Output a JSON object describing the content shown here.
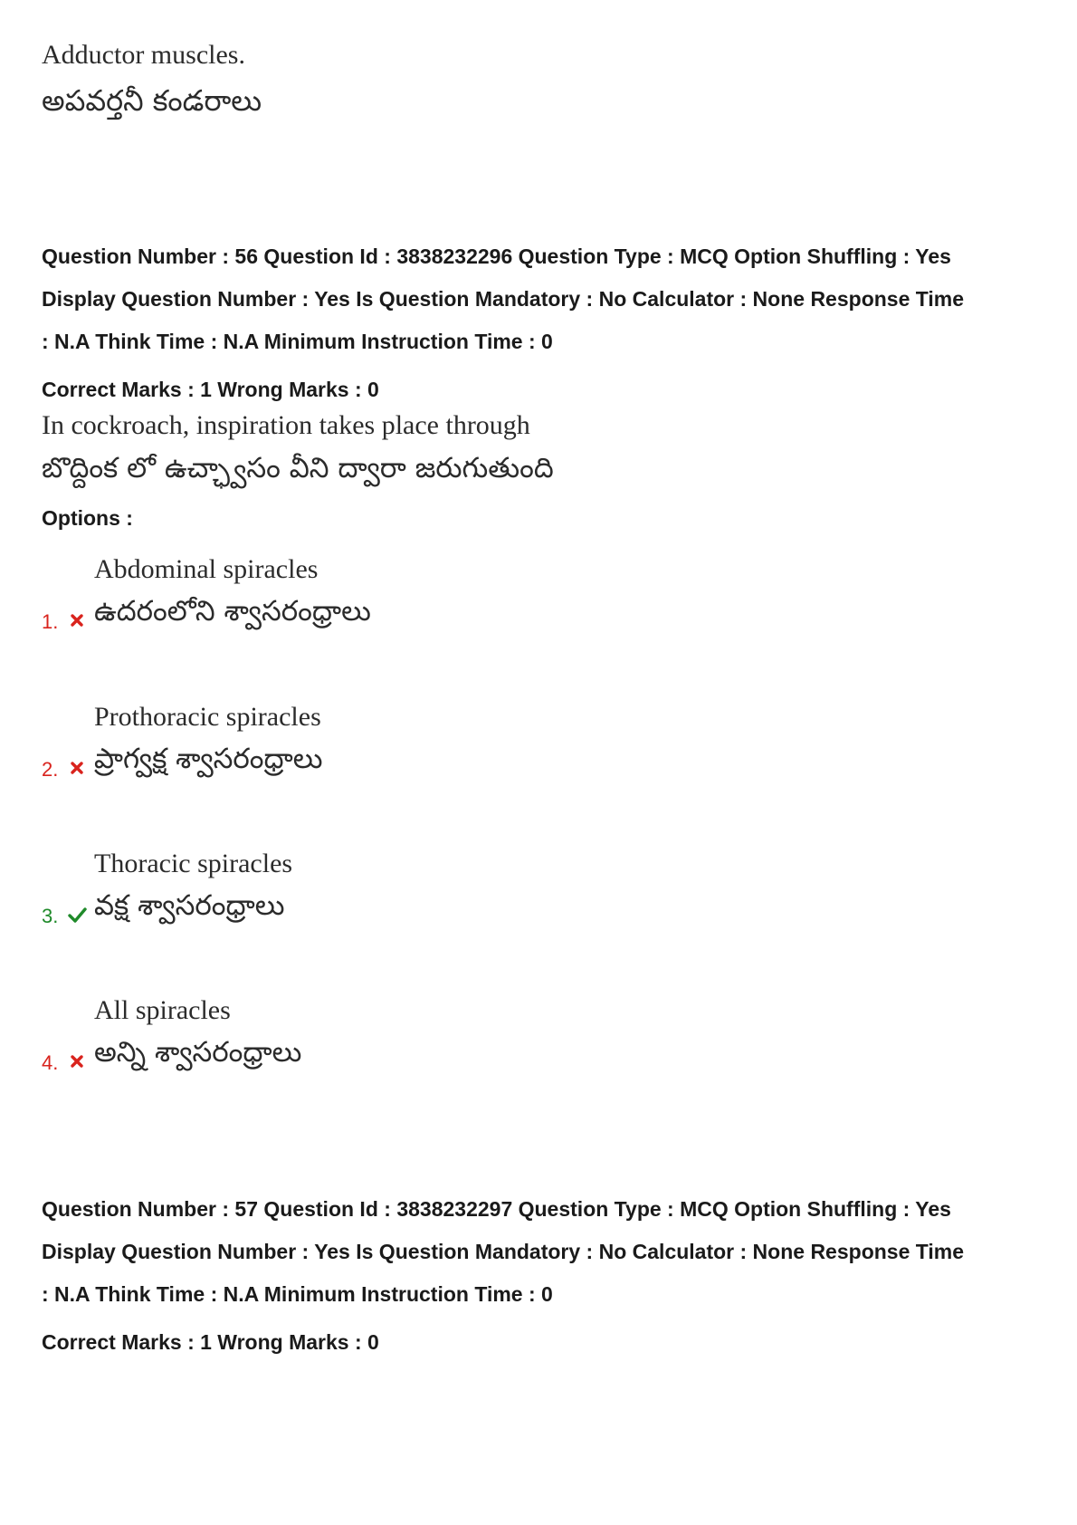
{
  "previous_answer": {
    "english": "Adductor muscles.",
    "telugu": "అపవర్తనీ కండరాలు"
  },
  "question_56": {
    "meta_line1": "Question Number : 56 Question Id : 3838232296 Question Type : MCQ Option Shuffling : Yes",
    "meta_line2": "Display Question Number : Yes Is Question Mandatory : No Calculator : None Response Time",
    "meta_line3": ": N.A Think Time : N.A Minimum Instruction Time : 0",
    "marks": "Correct Marks : 1 Wrong Marks : 0",
    "text_english": "In cockroach, inspiration takes place through",
    "text_telugu": "బొద్దింక లో ఉచ్ఛ్వాసం వీని ద్వారా జరుగుతుంది",
    "options_label": "Options :",
    "options": [
      {
        "number": "1.",
        "status": "wrong",
        "english": "Abdominal spiracles",
        "telugu": "ఉదరంలోని శ్వాసరంధ్రాలు"
      },
      {
        "number": "2.",
        "status": "wrong",
        "english": "Prothoracic spiracles",
        "telugu": "ప్రాగ్వక్ష శ్వాసరంధ్రాలు"
      },
      {
        "number": "3.",
        "status": "correct",
        "english": "Thoracic spiracles",
        "telugu": "వక్ష శ్వాసరంధ్రాలు"
      },
      {
        "number": "4.",
        "status": "wrong",
        "english": "All spiracles",
        "telugu": "అన్ని శ్వాసరంధ్రాలు"
      }
    ]
  },
  "question_57": {
    "meta_line1": "Question Number : 57 Question Id : 3838232297 Question Type : MCQ Option Shuffling : Yes",
    "meta_line2": "Display Question Number : Yes Is Question Mandatory : No Calculator : None Response Time",
    "meta_line3": ": N.A Think Time : N.A Minimum Instruction Time : 0",
    "marks": "Correct Marks : 1 Wrong Marks : 0"
  },
  "colors": {
    "wrong": "#d9231d",
    "correct": "#1f8a2a",
    "text": "#1a1a1a"
  },
  "icons": {
    "wrong": "cross-icon",
    "correct": "check-icon"
  }
}
